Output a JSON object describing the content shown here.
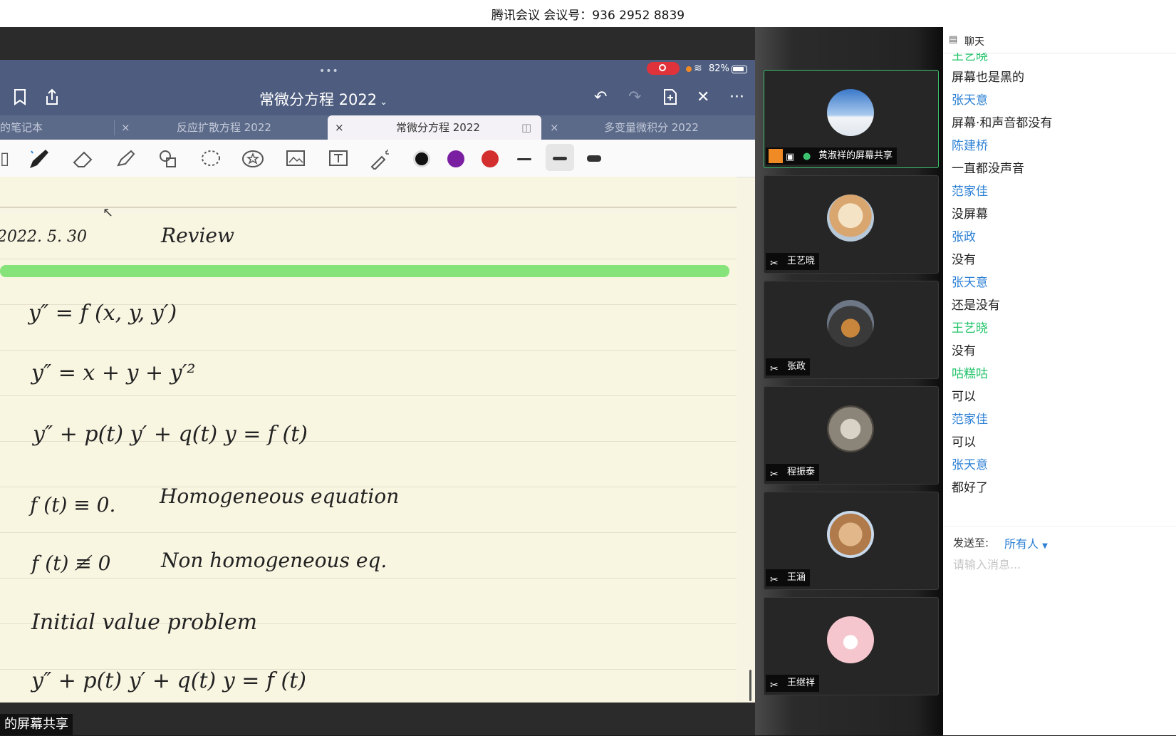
{
  "window": {
    "title": "腾讯会议 会议号：936 2952 8839"
  },
  "ipad": {
    "battery": "82%",
    "doc_title": "常微分方程 2022",
    "tabs": [
      {
        "label": "的笔记本",
        "active": false
      },
      {
        "label": "反应扩散方程 2022",
        "active": false
      },
      {
        "label": "常微分方程 2022",
        "active": true
      },
      {
        "label": "多变量微积分 2022",
        "active": false
      }
    ],
    "colors": [
      "#111111",
      "#7b1fa2",
      "#d32f2f"
    ],
    "notes": [
      "2022. 5. 30",
      "Review",
      "y″ = f (x, y, y′)",
      "y″ = x + y + y′²",
      "y″ + p(t) y′ + q(t) y = f (t)",
      "f (t) ≡ 0.",
      "Homogeneous equation",
      "f (t) ≢ 0",
      "Non homogeneous eq.",
      "Initial value problem",
      "y″ + p(t) y′ + q(t) y = f (t)"
    ]
  },
  "share_label": "的屏幕共享",
  "participants": [
    {
      "name": "黄淑祥的屏幕共享",
      "avatar": "mountain-photo"
    },
    {
      "name": "王艺晓",
      "avatar": "anime-character"
    },
    {
      "name": "张政",
      "avatar": "person-photo"
    },
    {
      "name": "程振泰",
      "avatar": "cat-photo"
    },
    {
      "name": "王涵",
      "avatar": "cat-photo"
    },
    {
      "name": "王继祥",
      "avatar": "cartoon-face"
    }
  ],
  "chat": {
    "title": "聊天",
    "messages": [
      {
        "type": "name",
        "text": "王艺晓",
        "color": "#22c36a"
      },
      {
        "type": "text",
        "text": "屏幕也是黑的"
      },
      {
        "type": "name",
        "text": "张天意",
        "color": "#2b7fd4"
      },
      {
        "type": "text",
        "text": "屏幕·和声音都没有"
      },
      {
        "type": "name",
        "text": "陈建桥",
        "color": "#2b7fd4"
      },
      {
        "type": "text",
        "text": "一直都没声音"
      },
      {
        "type": "name",
        "text": "范家佳",
        "color": "#2b7fd4"
      },
      {
        "type": "text",
        "text": "没屏幕"
      },
      {
        "type": "name",
        "text": "张政",
        "color": "#2b7fd4"
      },
      {
        "type": "text",
        "text": "没有"
      },
      {
        "type": "name",
        "text": "张天意",
        "color": "#2b7fd4"
      },
      {
        "type": "text",
        "text": "还是没有"
      },
      {
        "type": "name",
        "text": "王艺晓",
        "color": "#22c36a"
      },
      {
        "type": "text",
        "text": "没有"
      },
      {
        "type": "name",
        "text": "咕糕咕",
        "color": "#22c36a"
      },
      {
        "type": "text",
        "text": "可以"
      },
      {
        "type": "name",
        "text": "范家佳",
        "color": "#2b7fd4"
      },
      {
        "type": "text",
        "text": "可以"
      },
      {
        "type": "name",
        "text": "张天意",
        "color": "#2b7fd4"
      },
      {
        "type": "text",
        "text": "都好了"
      }
    ],
    "send_to_label": "发送至:",
    "send_to_value": "所有人",
    "input_placeholder": "请输入消息..."
  }
}
